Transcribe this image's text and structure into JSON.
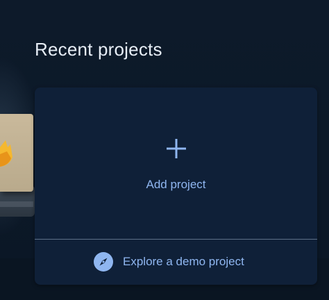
{
  "page": {
    "title": "Recent projects"
  },
  "add_project": {
    "label": "Add project",
    "icon": "plus-icon"
  },
  "explore_demo": {
    "label": "Explore a demo project",
    "icon": "compass-icon"
  },
  "colors": {
    "background": "#0c1928",
    "card": "#0f2038",
    "accent": "#8fb6f0",
    "title_text": "#e6edf5",
    "divider": "#5e7089"
  }
}
